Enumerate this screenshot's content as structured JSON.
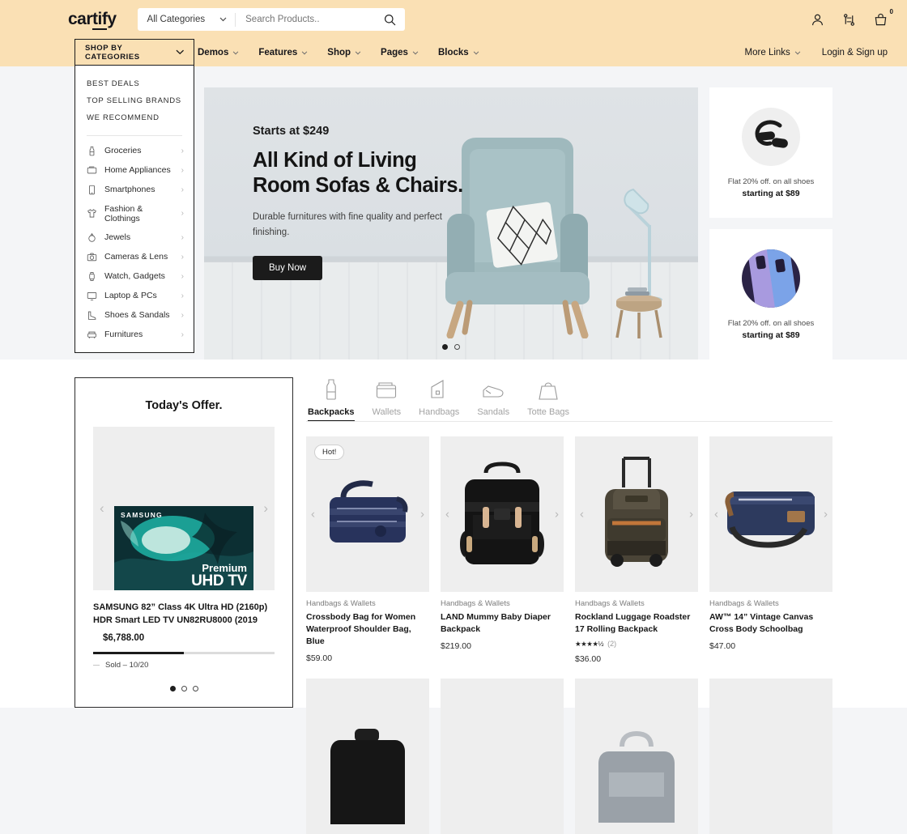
{
  "colors": {
    "header_bg": "#fae0b4",
    "page_bg": "#f4f5f7",
    "ink": "#1c1c1c",
    "accent": "#1b1b1b"
  },
  "header": {
    "brand": "cartify",
    "brand_plain": "car",
    "brand_underline": "tif",
    "brand_tail": "y",
    "category_select": "All Categories",
    "search_placeholder": "Search Products..",
    "icons": {
      "account": "user-icon",
      "compare": "compare-icon",
      "cart": "cart-icon"
    },
    "cart_count": "0"
  },
  "nav": {
    "items": [
      {
        "label": "Demos",
        "caret": true
      },
      {
        "label": "Features",
        "caret": true
      },
      {
        "label": "Shop",
        "caret": true
      },
      {
        "label": "Pages",
        "caret": true
      },
      {
        "label": "Blocks",
        "caret": true
      }
    ],
    "right": [
      {
        "label": "More Links",
        "caret": true
      },
      {
        "label": "Login & Sign up",
        "caret": false
      }
    ]
  },
  "categories": {
    "header": "SHOP BY CATEGORIES",
    "top_links": [
      "BEST DEALS",
      "TOP SELLING BRANDS",
      "WE RECOMMEND"
    ],
    "items": [
      {
        "label": "Groceries",
        "icon": "bottle-icon"
      },
      {
        "label": "Home Appliances",
        "icon": "tv-icon"
      },
      {
        "label": "Smartphones",
        "icon": "phone-icon"
      },
      {
        "label": "Fashion & Clothings",
        "icon": "tshirt-icon"
      },
      {
        "label": "Jewels",
        "icon": "ring-icon"
      },
      {
        "label": "Cameras & Lens",
        "icon": "camera-icon"
      },
      {
        "label": "Watch, Gadgets",
        "icon": "watch-icon"
      },
      {
        "label": "Laptop & PCs",
        "icon": "monitor-icon"
      },
      {
        "label": "Shoes & Sandals",
        "icon": "boot-icon"
      },
      {
        "label": "Furnitures",
        "icon": "sofa-icon"
      }
    ],
    "chevron": "›"
  },
  "hero": {
    "kicker": "Starts at $249",
    "title": "All Kind of Living Room Sofas & Chairs.",
    "subtitle": "Durable furnitures with fine quality and perfect finishing.",
    "cta": "Buy Now",
    "slides": 2,
    "active_slide": 1
  },
  "promos": [
    {
      "line1": "Flat 20% off. on all shoes",
      "line2": "starting at $89",
      "image": "headphones-image"
    },
    {
      "line1": "Flat 20% off. on all shoes",
      "line2": "starting at $89",
      "image": "smartphones-image"
    }
  ],
  "offer": {
    "title": "Today's Offer.",
    "tv_brand": "SAMSUNG",
    "tv_cap1": "Premium",
    "tv_cap2": "UHD TV",
    "product_name": "SAMSUNG 82” Class 4K Ultra HD (2160p) HDR Smart LED TV UN82RU8000 (2019",
    "price": "$6,788.00",
    "sold_label": "Sold – 10/20",
    "sold_percent": 50,
    "prev": "‹",
    "next": "›",
    "dots": 3,
    "active_dot": 1
  },
  "catalog": {
    "tabs": [
      {
        "label": "Backpacks",
        "icon": "bottle-icon",
        "active": true
      },
      {
        "label": "Wallets",
        "icon": "wallet-icon",
        "active": false
      },
      {
        "label": "Handbags",
        "icon": "handbag-icon",
        "active": false
      },
      {
        "label": "Sandals",
        "icon": "sandal-icon",
        "active": false
      },
      {
        "label": "Totte Bags",
        "icon": "tote-icon",
        "active": false
      }
    ],
    "products": [
      {
        "badge": "Hot!",
        "category": "Handbags & Wallets",
        "name": "Crossbody Bag for Women Waterproof Shoulder Bag, Blue",
        "price": "$59.00",
        "rating": null,
        "reviews": null,
        "image": "navy-crossbody-bag"
      },
      {
        "badge": null,
        "category": "Handbags & Wallets",
        "name": "LAND Mummy Baby Diaper Backpack",
        "price": "$219.00",
        "rating": null,
        "reviews": null,
        "image": "black-backpack"
      },
      {
        "badge": null,
        "category": "Handbags & Wallets",
        "name": "Rockland Luggage Roadster 17 Rolling Backpack",
        "price": "$36.00",
        "rating": "★★★★½",
        "reviews": "(2)",
        "image": "rolling-backpack"
      },
      {
        "badge": null,
        "category": "Handbags & Wallets",
        "name": "AW™ 14” Vintage Canvas Cross Body Schoolbag",
        "price": "$47.00",
        "rating": null,
        "reviews": null,
        "image": "canvas-messenger-bag"
      }
    ],
    "row2": [
      {
        "image": "black-backpack-2"
      },
      {
        "image": "placeholder-2"
      },
      {
        "image": "grey-backpack"
      },
      {
        "image": "placeholder-4"
      }
    ],
    "prev": "‹",
    "next": "›"
  }
}
